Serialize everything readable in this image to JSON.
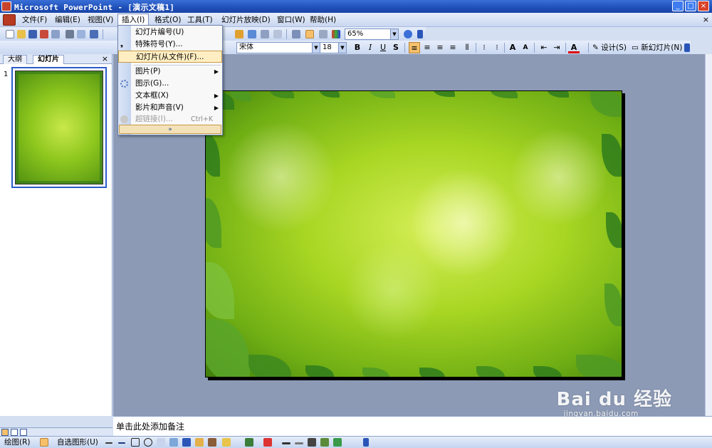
{
  "window": {
    "title": "Microsoft PowerPoint - [演示文稿1]",
    "controls": [
      "_",
      "□",
      "×"
    ]
  },
  "menubar": {
    "items": [
      {
        "label": "文件(F)"
      },
      {
        "label": "编辑(E)"
      },
      {
        "label": "视图(V)"
      },
      {
        "label": "插入(I)"
      },
      {
        "label": "格式(O)"
      },
      {
        "label": "工具(T)"
      },
      {
        "label": "幻灯片放映(D)"
      },
      {
        "label": "窗口(W)"
      },
      {
        "label": "帮助(H)"
      }
    ],
    "close": "×"
  },
  "standard_toolbar": {
    "zoom": "65%"
  },
  "formatting_toolbar": {
    "font": "宋体",
    "size": "18",
    "bold": "B",
    "italic": "I",
    "underline": "U",
    "shadow": "S",
    "font_grow": "A",
    "font_shrink": "A",
    "font_color": "A",
    "design": "设计(S)",
    "new_slide": "新幻灯片(N)"
  },
  "insert_menu": {
    "items": [
      {
        "label": "幻灯片编号(U)"
      },
      {
        "label": "特殊符号(Y)..."
      },
      {
        "label": "幻灯片(从文件)(F)..."
      },
      {
        "label": "图片(P)"
      },
      {
        "label": "图示(G)..."
      },
      {
        "label": "文本框(X)"
      },
      {
        "label": "影片和声音(V)"
      },
      {
        "label": "超链接(I)...",
        "shortcut": "Ctrl+K"
      }
    ],
    "submenu_arrow": "▶",
    "more": "»"
  },
  "left_pane": {
    "tabs": [
      "大纲",
      "幻灯片"
    ],
    "close": "×",
    "slide_number": "1"
  },
  "notes": {
    "placeholder": "单击此处添加备注"
  },
  "drawing_toolbar": {
    "draw": "绘图(R)",
    "autoshapes": "自选图形(U)"
  },
  "watermark": {
    "brand": "Bai du 经验",
    "url": "jingyan.baidu.com"
  },
  "colors": {
    "titlebar": "#1f4fb8",
    "menu_highlight": "#ffeec2",
    "slide_green": "#a8d623",
    "workarea": "#8c9ab6"
  }
}
